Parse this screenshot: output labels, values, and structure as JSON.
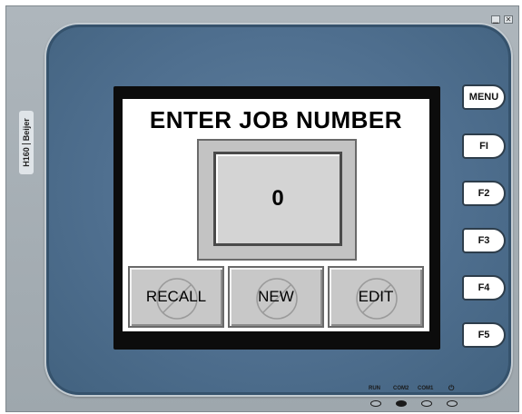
{
  "window": {
    "minimize_icon": "minimize-icon",
    "close_icon": "close-icon",
    "minimize_glyph": "▁",
    "close_glyph": "✕"
  },
  "device": {
    "brand_model": "H160",
    "brand_name": "Beijer"
  },
  "screen": {
    "title": "ENTER JOB NUMBER",
    "job_number_value": "0",
    "buttons": {
      "recall": "RECALL",
      "new": "NEW",
      "edit": "EDIT"
    },
    "button_icon": "disabled-circle-icon"
  },
  "function_keys": {
    "menu": "MENU",
    "f1": "FI",
    "f2": "F2",
    "f3": "F3",
    "f4": "F4",
    "f5": "F5"
  },
  "indicators": {
    "run_label": "RUN",
    "com2_label": "COM2",
    "com1_label": "COM1",
    "power_label": "⏻"
  },
  "colors": {
    "bezel": "#4f6f8f",
    "window_bg": "#aeb6bc",
    "button_face": "#c8c8c8",
    "display_bg": "#d4d4d4"
  }
}
